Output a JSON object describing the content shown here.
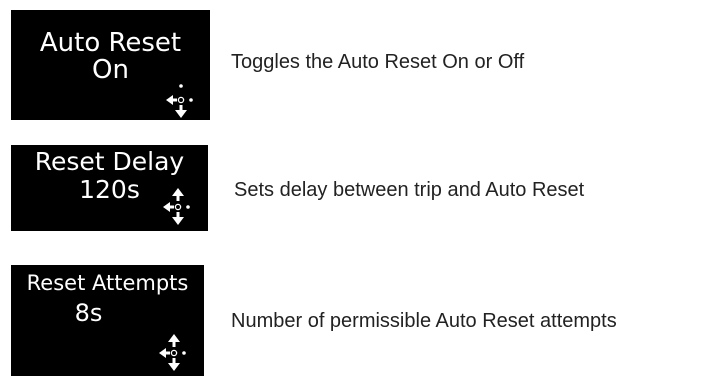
{
  "screens": [
    {
      "title": "Auto Reset",
      "value": "On",
      "nav_icon": "nav-cross-icon-left-down-right-up",
      "description": "Toggles the Auto Reset On or Off"
    },
    {
      "title": "Reset Delay",
      "value": "120s",
      "nav_icon": "nav-cross-icon-all-directions",
      "description": "Sets delay between trip and Auto Reset"
    },
    {
      "title": "Reset Attempts",
      "value": "8s",
      "nav_icon": "nav-cross-icon-all-directions",
      "description": "Number of permissible Auto Reset attempts"
    }
  ],
  "colors": {
    "screen_background": "#000000",
    "screen_text": "#ffffff",
    "description_text": "#222222",
    "page_background": "#ffffff"
  }
}
